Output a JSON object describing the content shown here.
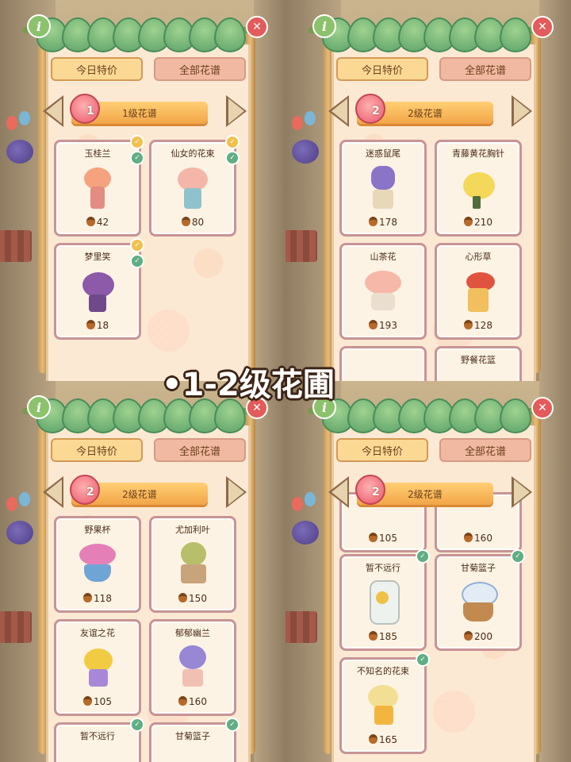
{
  "caption": "•1-2级花圃",
  "ui": {
    "tab_today": "今日特价",
    "tab_all": "全部花谱",
    "info_label": "i",
    "close_label": "✕",
    "check_label": "✓"
  },
  "panels": [
    {
      "level_number": "1",
      "level_title": "1级花谱",
      "cards": [
        {
          "name": "玉桂兰",
          "price": "42",
          "check": true
        },
        {
          "name": "仙女的花束",
          "price": "80",
          "check": true
        },
        {
          "name": "梦里笑",
          "price": "18",
          "check": true
        }
      ]
    },
    {
      "level_number": "2",
      "level_title": "2级花谱",
      "cards": [
        {
          "name": "迷惑鼠尾",
          "price": "178"
        },
        {
          "name": "青藤黄花胸针",
          "price": "210"
        },
        {
          "name": "山茶花",
          "price": "193"
        },
        {
          "name": "心形草",
          "price": "128"
        },
        {
          "name": "野餐花篮",
          "price": ""
        }
      ]
    },
    {
      "level_number": "2",
      "level_title": "2级花谱",
      "cards": [
        {
          "name": "野果杯",
          "price": "118"
        },
        {
          "name": "尤加利叶",
          "price": "150"
        },
        {
          "name": "友谊之花",
          "price": "105"
        },
        {
          "name": "郁郁幽兰",
          "price": "160"
        },
        {
          "name": "暂不远行",
          "price": ""
        },
        {
          "name": "甘菊篮子",
          "price": ""
        }
      ]
    },
    {
      "level_number": "2",
      "level_title": "2级花谱",
      "cards": [
        {
          "name": "",
          "price": "105"
        },
        {
          "name": "",
          "price": "160"
        },
        {
          "name": "暂不远行",
          "price": "185"
        },
        {
          "name": "甘菊篮子",
          "price": "200"
        },
        {
          "name": "不知名的花束",
          "price": "165"
        }
      ]
    }
  ],
  "colors": {
    "board": "#fbe9d4",
    "card_border": "#c79495",
    "ribbon": "#f2a548",
    "check": "#5fae84",
    "close": "#e35b5b",
    "info": "#8cc26c"
  }
}
